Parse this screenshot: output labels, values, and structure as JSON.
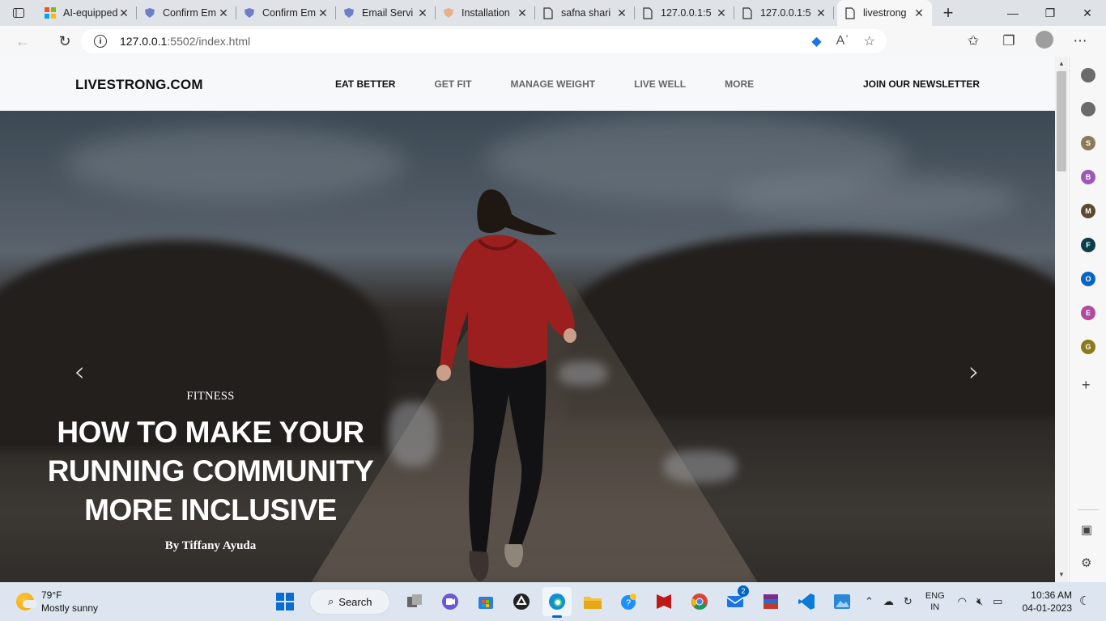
{
  "browser": {
    "tabs": [
      {
        "title": "AI-equipped",
        "favicon": "microsoft-icon"
      },
      {
        "title": "Confirm Em",
        "favicon": "shield-icon"
      },
      {
        "title": "Confirm Em",
        "favicon": "shield-icon"
      },
      {
        "title": "Email Servi",
        "favicon": "shield-icon"
      },
      {
        "title": "Installation",
        "favicon": "cloud-icon"
      },
      {
        "title": "safna shari",
        "favicon": "page-icon"
      },
      {
        "title": "127.0.0.1:5",
        "favicon": "page-icon"
      },
      {
        "title": "127.0.0.1:5",
        "favicon": "page-icon"
      },
      {
        "title": "livestrong",
        "favicon": "page-icon",
        "active": true
      }
    ],
    "address": {
      "host": "127.0.0.1",
      "path": ":5502/index.html"
    }
  },
  "site": {
    "logo": "LIVESTRONG.COM",
    "nav": [
      "EAT BETTER",
      "GET FIT",
      "MANAGE WEIGHT",
      "LIVE WELL",
      "MORE"
    ],
    "newsletter": "JOIN OUR NEWSLETTER",
    "hero": {
      "category": "FITNESS",
      "headline": "HOW TO MAKE YOUR RUNNING COMMUNITY MORE INCLUSIVE",
      "byline": "By Tiffany Ayuda"
    }
  },
  "sidebar": {
    "items": [
      {
        "letter": "",
        "color": "#6b6b6b"
      },
      {
        "letter": "",
        "color": "#6b6b6b"
      },
      {
        "letter": "S",
        "color": "#8a7a5a"
      },
      {
        "letter": "B",
        "color": "#9b59b6"
      },
      {
        "letter": "M",
        "color": "#5b4a2e"
      },
      {
        "letter": "F",
        "color": "#0b3d4a"
      },
      {
        "letter": "O",
        "color": "#0a64c2"
      },
      {
        "letter": "E",
        "color": "#b04aa0"
      },
      {
        "letter": "G",
        "color": "#8a7a1a"
      }
    ]
  },
  "taskbar": {
    "weather": {
      "temp": "79°F",
      "desc": "Mostly sunny"
    },
    "search": "Search",
    "mail_badge": "2",
    "lang": {
      "line1": "ENG",
      "line2": "IN"
    },
    "clock": {
      "time": "10:36 AM",
      "date": "04-01-2023"
    }
  }
}
